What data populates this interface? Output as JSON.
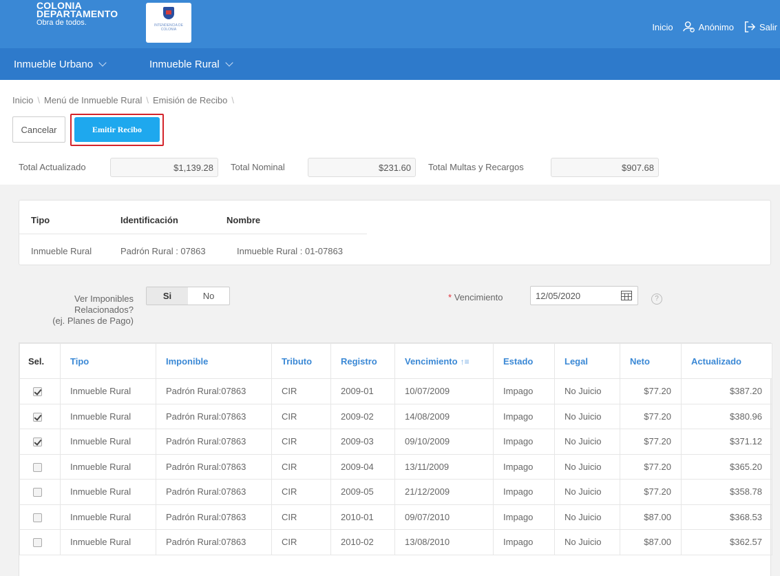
{
  "brand": {
    "line1": "COLONIA",
    "line2": "DEPARTAMENTO",
    "line3": "Obra de todos.",
    "badge_text": "INTENDENCIA DE COLONIA"
  },
  "top_nav": {
    "home": "Inicio",
    "user": "Anónimo",
    "logout": "Salir"
  },
  "menu": {
    "urban": "Inmueble Urbano",
    "rural": "Inmueble Rural"
  },
  "breadcrumb": [
    "Inicio",
    "Menú de Inmueble Rural",
    "Emisión de Recibo"
  ],
  "actions": {
    "cancel": "Cancelar",
    "emit": "Emitir Recibo"
  },
  "totals": {
    "actualizado_label": "Total Actualizado",
    "actualizado_value": "$1,139.28",
    "nominal_label": "Total Nominal",
    "nominal_value": "$231.60",
    "multas_label": "Total Multas y Recargos",
    "multas_value": "$907.68"
  },
  "info": {
    "headers": [
      "Tipo",
      "Identificación",
      "Nombre"
    ],
    "values": [
      "Inmueble Rural",
      "Padrón Rural : 07863",
      "Inmueble Rural : 01-07863"
    ]
  },
  "filters": {
    "ver_label_1": "Ver Imponibles",
    "ver_label_2": "Relacionados?",
    "ver_label_3": "(ej. Planes de Pago)",
    "toggle_yes": "Si",
    "toggle_no": "No",
    "toggle_selected": "Si",
    "venc_required": "*",
    "venc_label": "Vencimiento",
    "venc_value": "12/05/2020",
    "help": "?"
  },
  "table": {
    "headers": [
      "Sel.",
      "Tipo",
      "Imponible",
      "Tributo",
      "Registro",
      "Vencimiento",
      "Estado",
      "Legal",
      "Neto",
      "Actualizado"
    ],
    "rows": [
      {
        "sel": true,
        "tipo": "Inmueble Rural",
        "imponible": "Padrón Rural:07863",
        "tributo": "CIR",
        "registro": "2009-01",
        "vencimiento": "10/07/2009",
        "estado": "Impago",
        "legal": "No Juicio",
        "neto": "$77.20",
        "actualizado": "$387.20"
      },
      {
        "sel": true,
        "tipo": "Inmueble Rural",
        "imponible": "Padrón Rural:07863",
        "tributo": "CIR",
        "registro": "2009-02",
        "vencimiento": "14/08/2009",
        "estado": "Impago",
        "legal": "No Juicio",
        "neto": "$77.20",
        "actualizado": "$380.96"
      },
      {
        "sel": true,
        "tipo": "Inmueble Rural",
        "imponible": "Padrón Rural:07863",
        "tributo": "CIR",
        "registro": "2009-03",
        "vencimiento": "09/10/2009",
        "estado": "Impago",
        "legal": "No Juicio",
        "neto": "$77.20",
        "actualizado": "$371.12"
      },
      {
        "sel": false,
        "tipo": "Inmueble Rural",
        "imponible": "Padrón Rural:07863",
        "tributo": "CIR",
        "registro": "2009-04",
        "vencimiento": "13/11/2009",
        "estado": "Impago",
        "legal": "No Juicio",
        "neto": "$77.20",
        "actualizado": "$365.20"
      },
      {
        "sel": false,
        "tipo": "Inmueble Rural",
        "imponible": "Padrón Rural:07863",
        "tributo": "CIR",
        "registro": "2009-05",
        "vencimiento": "21/12/2009",
        "estado": "Impago",
        "legal": "No Juicio",
        "neto": "$77.20",
        "actualizado": "$358.78"
      },
      {
        "sel": false,
        "tipo": "Inmueble Rural",
        "imponible": "Padrón Rural:07863",
        "tributo": "CIR",
        "registro": "2010-01",
        "vencimiento": "09/07/2010",
        "estado": "Impago",
        "legal": "No Juicio",
        "neto": "$87.00",
        "actualizado": "$368.53"
      },
      {
        "sel": false,
        "tipo": "Inmueble Rural",
        "imponible": "Padrón Rural:07863",
        "tributo": "CIR",
        "registro": "2010-02",
        "vencimiento": "13/08/2010",
        "estado": "Impago",
        "legal": "No Juicio",
        "neto": "$87.00",
        "actualizado": "$362.57"
      }
    ]
  },
  "colors": {
    "topbar": "#3a88d5",
    "menubar": "#2e7acb",
    "primary_button": "#1ea8ee",
    "highlight_outline": "#d4232a"
  }
}
